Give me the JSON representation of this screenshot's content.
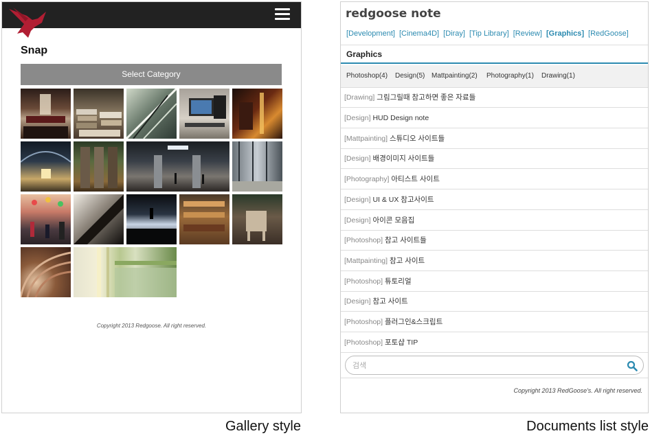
{
  "gallery": {
    "title": "Snap",
    "select_category_label": "Select Category",
    "copyright": "Copyright 2013 Redgoose. All right reserved.",
    "caption": "Gallery style",
    "logo_icon": "redgoose-bird-logo-icon",
    "menu_icon": "hamburger-menu-icon",
    "header_color": "#222222",
    "logo_color": "#b11e33",
    "button_color": "#8a8a8a"
  },
  "docs": {
    "brand": "redgoose note",
    "categories": [
      {
        "label": "[Development]",
        "active": false
      },
      {
        "label": "[Cinema4D]",
        "active": false
      },
      {
        "label": "[Diray]",
        "active": false
      },
      {
        "label": "[Tip Library]",
        "active": false
      },
      {
        "label": "[Review]",
        "active": false
      },
      {
        "label": "[Graphics]",
        "active": true
      },
      {
        "label": "[RedGoose]",
        "active": false
      }
    ],
    "section_title": "Graphics",
    "subcategories": [
      "Photoshop(4)",
      "Design(5)",
      "Mattpainting(2)",
      "Photography(1)",
      "Drawing(1)"
    ],
    "items": [
      {
        "tag": "[Drawing]",
        "title": "그림그릴때 참고하면 좋은 자료들"
      },
      {
        "tag": "[Design]",
        "title": "HUD Design note"
      },
      {
        "tag": "[Mattpainting]",
        "title": "스튜디오 사이트들"
      },
      {
        "tag": "[Design]",
        "title": "배경이미지 사이트들"
      },
      {
        "tag": "[Photography]",
        "title": "아티스트 사이트"
      },
      {
        "tag": "[Design]",
        "title": "UI & UX 참고사이트"
      },
      {
        "tag": "[Design]",
        "title": "아이콘 모음집"
      },
      {
        "tag": "[Photoshop]",
        "title": "참고 사이트들"
      },
      {
        "tag": "[Mattpainting]",
        "title": "참고 사이트"
      },
      {
        "tag": "[Photoshop]",
        "title": "튜토리얼"
      },
      {
        "tag": "[Design]",
        "title": "참고 사이트"
      },
      {
        "tag": "[Photoshop]",
        "title": "플러그인&스크립트"
      },
      {
        "tag": "[Photoshop]",
        "title": "포토샵 TIP"
      }
    ],
    "search_placeholder": "검색",
    "copyright": "Copyright 2013 RedGoose's. All right reserved.",
    "caption": "Documents list style",
    "accent_color": "#2b8ab0",
    "search_icon": "search-icon"
  }
}
